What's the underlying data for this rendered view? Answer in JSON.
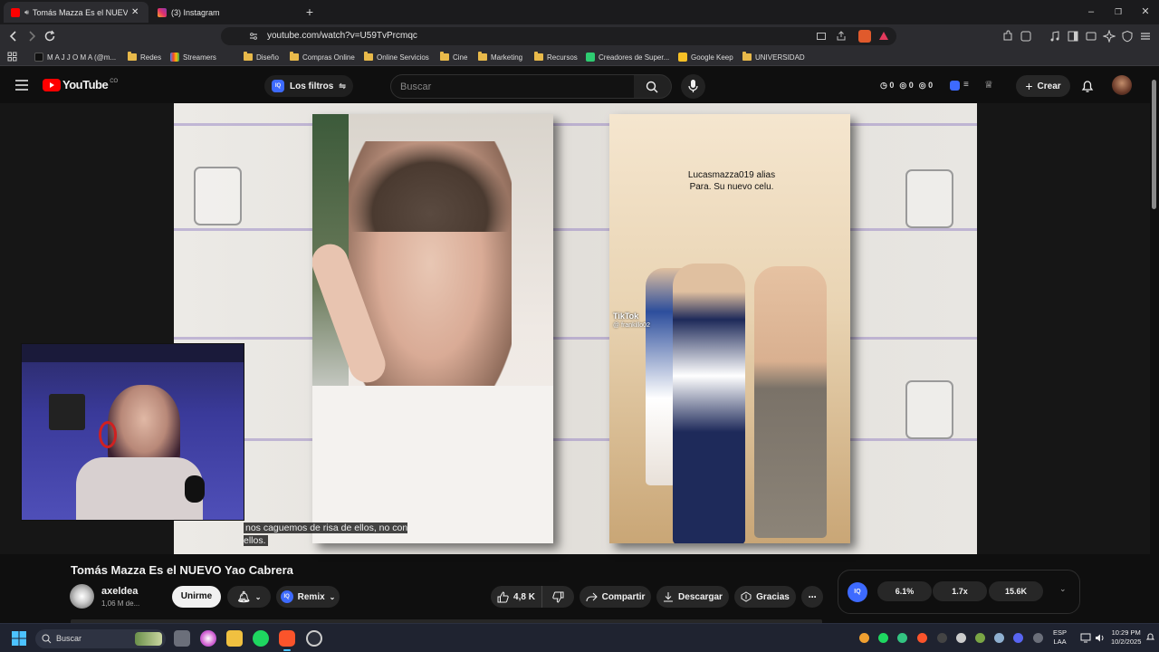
{
  "browser": {
    "tabs": [
      {
        "label": "Tomás Mazza Es el NUEVO Ya",
        "active": true
      },
      {
        "label": "(3) Instagram",
        "active": false
      }
    ],
    "url": "youtube.com/watch?v=U59TvPrcmqc",
    "bookmarks": [
      {
        "label": "M A J J O M A (@m...",
        "icon": "tiktok-icon"
      },
      {
        "label": "Redes",
        "icon": "folder-icon"
      },
      {
        "label": "Streamers",
        "icon": "folder-icon"
      },
      {
        "label": "Diseño",
        "icon": "folder-icon"
      },
      {
        "label": "Compras Online",
        "icon": "folder-icon"
      },
      {
        "label": "Online Servicios",
        "icon": "folder-icon"
      },
      {
        "label": "Cine",
        "icon": "folder-icon"
      },
      {
        "label": "Marketing",
        "icon": "folder-icon"
      },
      {
        "label": "Recursos",
        "icon": "folder-icon"
      },
      {
        "label": "Creadores de Super...",
        "icon": "site-icon"
      },
      {
        "label": "Google Keep",
        "icon": "keep-icon"
      },
      {
        "label": "UNIVERSIDAD",
        "icon": "folder-icon"
      }
    ]
  },
  "youtube": {
    "country_code": "CO",
    "filters_label": "Los filtros",
    "search_placeholder": "Buscar",
    "counters": [
      "0",
      "0",
      "0"
    ],
    "create_label": "Crear"
  },
  "video": {
    "overlay_text": "Lucasmazza019 alias Para. Su nuevo celu.",
    "tiktok_label": "TikTok",
    "tiktok_user": "@ frankillo02",
    "caption": "nos caguemos de risa de ellos, no con ellos.",
    "title": "Tomás Mazza Es el NUEVO Yao Cabrera",
    "channel": "axeldea",
    "subscribers": "1,06 M de...",
    "join_label": "Unirme",
    "remix_label": "Remix",
    "likes": "4,8 K",
    "share_label": "Compartir",
    "download_label": "Descargar",
    "thanks_label": "Gracias",
    "stats": [
      "6.1%",
      "1.7x",
      "15.6K"
    ],
    "stats_badge": "IQ"
  },
  "taskbar": {
    "search_label": "Buscar",
    "lang_line1": "ESP",
    "lang_line2": "LAA",
    "time": "10:29 PM",
    "date": "10/2/2025"
  },
  "colors": {
    "youtube_red": "#ff0000",
    "accent_blue": "#3d6aff",
    "page_bg": "#0f0f0f"
  }
}
